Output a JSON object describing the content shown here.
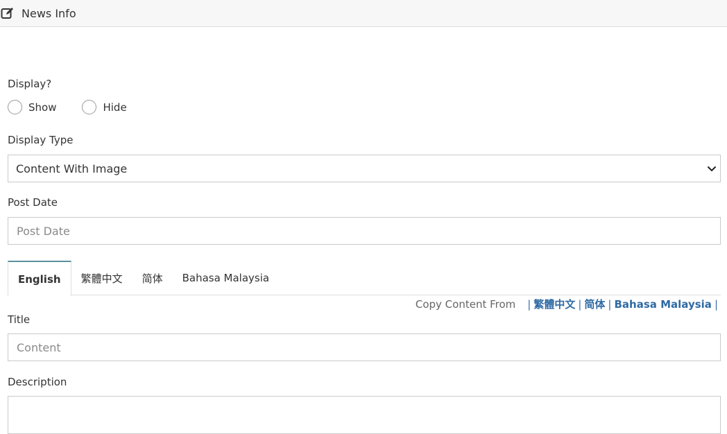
{
  "header": {
    "title": "News Info",
    "icon": "edit-icon"
  },
  "display": {
    "label": "Display?",
    "options": [
      {
        "label": "Show"
      },
      {
        "label": "Hide"
      }
    ]
  },
  "display_type": {
    "label": "Display Type",
    "value": "Content With Image"
  },
  "post_date": {
    "label": "Post Date",
    "placeholder": "Post Date"
  },
  "tabs": [
    {
      "label": "English",
      "active": true
    },
    {
      "label": "繁體中文"
    },
    {
      "label": "简体"
    },
    {
      "label": "Bahasa Malaysia"
    }
  ],
  "copy_content": {
    "label": "Copy Content From",
    "links": [
      "繁體中文",
      "简体",
      "Bahasa Malaysia"
    ]
  },
  "title_field": {
    "label": "Title",
    "placeholder": "Content"
  },
  "description": {
    "label": "Description"
  },
  "colors": {
    "tab_accent": "#5a8f9a",
    "link": "#2f6aa3"
  }
}
